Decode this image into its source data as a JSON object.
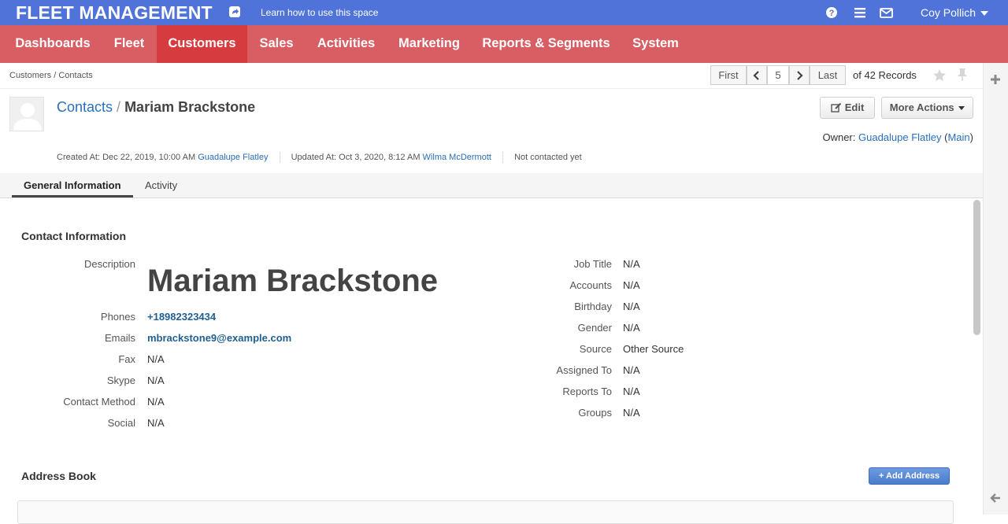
{
  "topbar": {
    "brand": "FLEET MANAGEMENT",
    "learn_text": "Learn how to use this space",
    "user_name": "Coy Pollich"
  },
  "nav": {
    "items": [
      {
        "label": "Dashboards",
        "active": false
      },
      {
        "label": "Fleet",
        "active": false
      },
      {
        "label": "Customers",
        "active": true
      },
      {
        "label": "Sales",
        "active": false
      },
      {
        "label": "Activities",
        "active": false
      },
      {
        "label": "Marketing",
        "active": false
      },
      {
        "label": "Reports & Segments",
        "active": false
      },
      {
        "label": "System",
        "active": false
      }
    ]
  },
  "breadcrumb": "Customers / Contacts",
  "pager": {
    "first": "First",
    "current": "5",
    "last": "Last",
    "records": "of 42 Records"
  },
  "header": {
    "section_link": "Contacts",
    "separator": "/",
    "name": "Mariam Brackstone",
    "edit_label": "Edit",
    "more_actions_label": "More Actions",
    "owner_label": "Owner:",
    "owner_name": "Guadalupe Flatley",
    "owner_bu": "Main"
  },
  "meta": {
    "created_label": "Created At: Dec 22, 2019, 10:00 AM",
    "created_by": "Guadalupe Flatley",
    "updated_label": "Updated At: Oct 3, 2020, 8:12 AM",
    "updated_by": "Wilma McDermott",
    "contacted": "Not contacted yet"
  },
  "tabs": {
    "general": "General Information",
    "activity": "Activity"
  },
  "contact_info": {
    "title": "Contact Information",
    "left": {
      "description_label": "Description",
      "description_value": "Mariam Brackstone",
      "phones_label": "Phones",
      "phones_value": "+18982323434",
      "emails_label": "Emails",
      "emails_value": "mbrackstone9@example.com",
      "fax_label": "Fax",
      "fax_value": "N/A",
      "skype_label": "Skype",
      "skype_value": "N/A",
      "contact_method_label": "Contact Method",
      "contact_method_value": "N/A",
      "social_label": "Social",
      "social_value": "N/A"
    },
    "right": {
      "job_title_label": "Job Title",
      "job_title_value": "N/A",
      "accounts_label": "Accounts",
      "accounts_value": "N/A",
      "birthday_label": "Birthday",
      "birthday_value": "N/A",
      "gender_label": "Gender",
      "gender_value": "N/A",
      "source_label": "Source",
      "source_value": "Other Source",
      "assigned_to_label": "Assigned To",
      "assigned_to_value": "N/A",
      "reports_to_label": "Reports To",
      "reports_to_value": "N/A",
      "groups_label": "Groups",
      "groups_value": "N/A"
    }
  },
  "address_book": {
    "title": "Address Book",
    "add_label": "+ Add Address"
  }
}
